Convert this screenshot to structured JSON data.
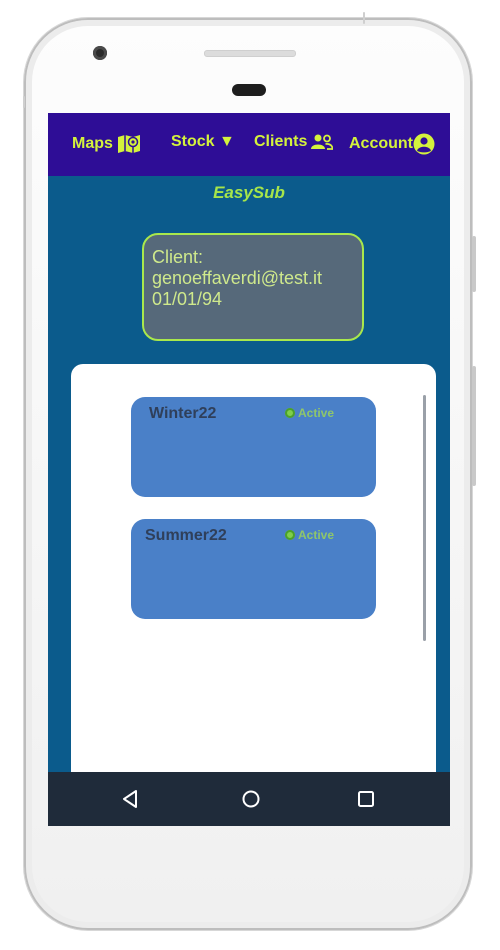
{
  "nav": {
    "maps_label": "Maps",
    "stock_label": "Stock ▼",
    "clients_label": "Clients",
    "account_label": "Account"
  },
  "app": {
    "title": "EasySub"
  },
  "client": {
    "label": "Client:",
    "email": "genoeffaverdi@test.it",
    "date": "01/01/94"
  },
  "subscriptions": [
    {
      "name": "Winter22",
      "status": "Active"
    },
    {
      "name": "Summer22",
      "status": "Active"
    }
  ],
  "colors": {
    "nav_bg": "#2e0d96",
    "screen_bg": "#0b5b8c",
    "accent": "#d4f23c",
    "card_bg": "#4a80c8",
    "active": "#7fcf4a"
  },
  "icons": {
    "maps": "map-pin-icon",
    "clients": "people-icon",
    "account": "user-circle-icon",
    "system": [
      "back-icon",
      "home-icon",
      "recents-icon"
    ]
  }
}
